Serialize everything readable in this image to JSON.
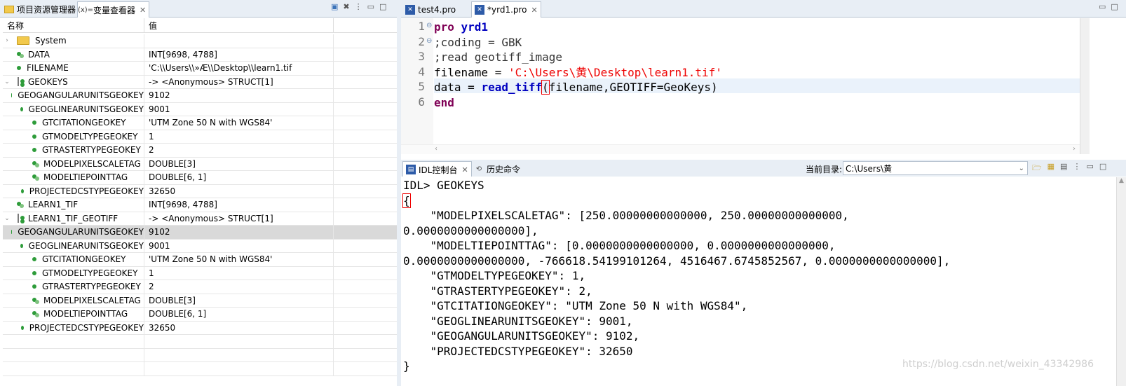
{
  "left_panel": {
    "tabs": [
      {
        "label": "项目资源管理器",
        "icon": "folder-icon"
      },
      {
        "label": "变量查看器",
        "icon": "variable-icon"
      }
    ],
    "columns": [
      "名称",
      "值"
    ],
    "rows": [
      {
        "name": "System",
        "value": "",
        "icon": "folder-icon",
        "indent": 0,
        "twisty": "›"
      },
      {
        "name": "DATA",
        "value": "INT[9698, 4788]",
        "icon": "array-icon",
        "indent": 0,
        "twisty": ""
      },
      {
        "name": "FILENAME",
        "value": "'C:\\\\Users\\\\»Æ\\\\Desktop\\\\learn1.tif",
        "icon": "scalar-icon",
        "indent": 0,
        "twisty": ""
      },
      {
        "name": "GEOKEYS",
        "value": "-> <Anonymous> STRUCT[1]",
        "icon": "struct-icon",
        "indent": 0,
        "twisty": "⌄"
      },
      {
        "name": "GEOGANGULARUNITSGEOKEY",
        "value": "9102",
        "icon": "scalar-icon",
        "indent": 1,
        "twisty": ""
      },
      {
        "name": "GEOGLINEARUNITSGEOKEY",
        "value": "9001",
        "icon": "scalar-icon",
        "indent": 1,
        "twisty": ""
      },
      {
        "name": "GTCITATIONGEOKEY",
        "value": "'UTM Zone 50 N with WGS84'",
        "icon": "scalar-icon",
        "indent": 1,
        "twisty": ""
      },
      {
        "name": "GTMODELTYPEGEOKEY",
        "value": "1",
        "icon": "scalar-icon",
        "indent": 1,
        "twisty": ""
      },
      {
        "name": "GTRASTERTYPEGEOKEY",
        "value": "2",
        "icon": "scalar-icon",
        "indent": 1,
        "twisty": ""
      },
      {
        "name": "MODELPIXELSCALETAG",
        "value": "DOUBLE[3]",
        "icon": "array-icon",
        "indent": 1,
        "twisty": ""
      },
      {
        "name": "MODELTIEPOINTTAG",
        "value": "DOUBLE[6, 1]",
        "icon": "array-icon",
        "indent": 1,
        "twisty": ""
      },
      {
        "name": "PROJECTEDCSTYPEGEOKEY",
        "value": "32650",
        "icon": "scalar-icon",
        "indent": 1,
        "twisty": ""
      },
      {
        "name": "LEARN1_TIF",
        "value": "INT[9698, 4788]",
        "icon": "array-icon",
        "indent": 0,
        "twisty": ""
      },
      {
        "name": "LEARN1_TIF_GEOTIFF",
        "value": "-> <Anonymous> STRUCT[1]",
        "icon": "struct-icon",
        "indent": 0,
        "twisty": "⌄"
      },
      {
        "name": "GEOGANGULARUNITSGEOKEY",
        "value": "9102",
        "icon": "scalar-icon",
        "indent": 1,
        "twisty": "",
        "selected": true
      },
      {
        "name": "GEOGLINEARUNITSGEOKEY",
        "value": "9001",
        "icon": "scalar-icon",
        "indent": 1,
        "twisty": ""
      },
      {
        "name": "GTCITATIONGEOKEY",
        "value": "'UTM Zone 50 N with WGS84'",
        "icon": "scalar-icon",
        "indent": 1,
        "twisty": ""
      },
      {
        "name": "GTMODELTYPEGEOKEY",
        "value": "1",
        "icon": "scalar-icon",
        "indent": 1,
        "twisty": ""
      },
      {
        "name": "GTRASTERTYPEGEOKEY",
        "value": "2",
        "icon": "scalar-icon",
        "indent": 1,
        "twisty": ""
      },
      {
        "name": "MODELPIXELSCALETAG",
        "value": "DOUBLE[3]",
        "icon": "array-icon",
        "indent": 1,
        "twisty": ""
      },
      {
        "name": "MODELTIEPOINTTAG",
        "value": "DOUBLE[6, 1]",
        "icon": "array-icon",
        "indent": 1,
        "twisty": ""
      },
      {
        "name": "PROJECTEDCSTYPEGEOKEY",
        "value": "32650",
        "icon": "scalar-icon",
        "indent": 1,
        "twisty": ""
      }
    ]
  },
  "editor": {
    "tabs": [
      {
        "label": "test4.pro",
        "icon": "idl-file-icon"
      },
      {
        "label": "*yrd1.pro",
        "icon": "idl-file-icon"
      }
    ],
    "line_numbers": [
      "1",
      "2",
      "3",
      "4",
      "5",
      "6"
    ],
    "lines": [
      [
        {
          "t": "pro ",
          "c": "kw"
        },
        {
          "t": "yrd1",
          "c": "fn"
        }
      ],
      [
        {
          "t": ";coding = GBK",
          "c": "cm"
        }
      ],
      [
        {
          "t": ";read geotiff_image",
          "c": "cm"
        }
      ],
      [
        {
          "t": "filename = ",
          "c": ""
        },
        {
          "t": "'C:\\Users\\黄\\Desktop\\learn1.tif'",
          "c": "str"
        }
      ],
      [
        {
          "t": "data = ",
          "c": ""
        },
        {
          "t": "read_tiff",
          "c": "fn"
        },
        {
          "t": "(",
          "c": "brace"
        },
        {
          "t": "filename,GEOTIFF=GeoKeys)",
          "c": ""
        }
      ],
      [
        {
          "t": "end",
          "c": "kw"
        }
      ]
    ]
  },
  "console": {
    "tabs": [
      {
        "label": "IDL控制台",
        "icon": "console-icon"
      },
      {
        "label": "历史命令",
        "icon": "history-icon"
      }
    ],
    "cwd_label": "当前目录:",
    "cwd_value": "C:\\Users\\黄",
    "lines": [
      "IDL> GEOKEYS",
      "{",
      "    \"MODELPIXELSCALETAG\": [250.00000000000000, 250.00000000000000,",
      "0.0000000000000000],",
      "    \"MODELTIEPOINTTAG\": [0.0000000000000000, 0.0000000000000000,",
      "0.0000000000000000, -766618.54199101264, 4516467.6745852567, 0.0000000000000000],",
      "    \"GTMODELTYPEGEOKEY\": 1,",
      "    \"GTRASTERTYPEGEOKEY\": 2,",
      "    \"GTCITATIONGEOKEY\": \"UTM Zone 50 N with WGS84\",",
      "    \"GEOGLINEARUNITSGEOKEY\": 9001,",
      "    \"GEOGANGULARUNITSGEOKEY\": 9102,",
      "    \"PROJECTEDCSTYPEGEOKEY\": 32650",
      "}"
    ],
    "watermark": "https://blog.csdn.net/weixin_43342986"
  }
}
